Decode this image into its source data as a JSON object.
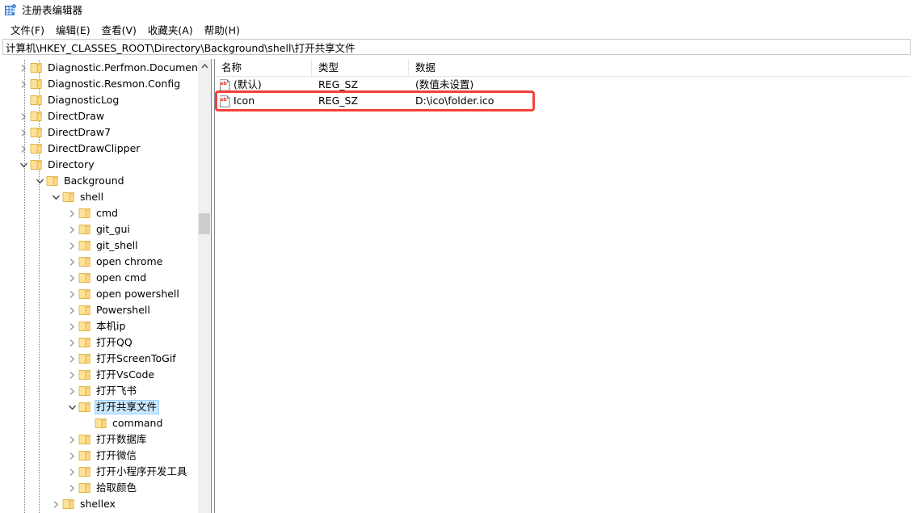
{
  "window": {
    "title": "注册表编辑器",
    "icon": "registry-editor-icon"
  },
  "menu": {
    "items": [
      {
        "label": "文件(F)",
        "name": "menu-file"
      },
      {
        "label": "编辑(E)",
        "name": "menu-edit"
      },
      {
        "label": "查看(V)",
        "name": "menu-view"
      },
      {
        "label": "收藏夹(A)",
        "name": "menu-favorites"
      },
      {
        "label": "帮助(H)",
        "name": "menu-help"
      }
    ]
  },
  "address": {
    "path": "计算机\\HKEY_CLASSES_ROOT\\Directory\\Background\\shell\\打开共享文件"
  },
  "tree": {
    "nodes": [
      {
        "label": "Diagnostic.Perfmon.Document",
        "depth": 1,
        "state": "collapsed",
        "selected": false
      },
      {
        "label": "Diagnostic.Resmon.Config",
        "depth": 1,
        "state": "collapsed",
        "selected": false
      },
      {
        "label": "DiagnosticLog",
        "depth": 1,
        "state": "leaf",
        "selected": false
      },
      {
        "label": "DirectDraw",
        "depth": 1,
        "state": "collapsed",
        "selected": false
      },
      {
        "label": "DirectDraw7",
        "depth": 1,
        "state": "collapsed",
        "selected": false
      },
      {
        "label": "DirectDrawClipper",
        "depth": 1,
        "state": "collapsed",
        "selected": false
      },
      {
        "label": "Directory",
        "depth": 1,
        "state": "expanded",
        "selected": false
      },
      {
        "label": "Background",
        "depth": 2,
        "state": "expanded",
        "selected": false
      },
      {
        "label": "shell",
        "depth": 3,
        "state": "expanded",
        "selected": false
      },
      {
        "label": "cmd",
        "depth": 4,
        "state": "collapsed",
        "selected": false
      },
      {
        "label": "git_gui",
        "depth": 4,
        "state": "collapsed",
        "selected": false
      },
      {
        "label": "git_shell",
        "depth": 4,
        "state": "collapsed",
        "selected": false
      },
      {
        "label": "open chrome",
        "depth": 4,
        "state": "collapsed",
        "selected": false
      },
      {
        "label": "open cmd",
        "depth": 4,
        "state": "collapsed",
        "selected": false
      },
      {
        "label": "open powershell",
        "depth": 4,
        "state": "collapsed",
        "selected": false
      },
      {
        "label": "Powershell",
        "depth": 4,
        "state": "collapsed",
        "selected": false
      },
      {
        "label": "本机ip",
        "depth": 4,
        "state": "collapsed",
        "selected": false
      },
      {
        "label": "打开QQ",
        "depth": 4,
        "state": "collapsed",
        "selected": false
      },
      {
        "label": "打开ScreenToGif",
        "depth": 4,
        "state": "collapsed",
        "selected": false
      },
      {
        "label": "打开VsCode",
        "depth": 4,
        "state": "collapsed",
        "selected": false
      },
      {
        "label": "打开飞书",
        "depth": 4,
        "state": "collapsed",
        "selected": false
      },
      {
        "label": "打开共享文件",
        "depth": 4,
        "state": "expanded",
        "selected": true
      },
      {
        "label": "command",
        "depth": 5,
        "state": "leaf",
        "selected": false
      },
      {
        "label": "打开数据库",
        "depth": 4,
        "state": "collapsed",
        "selected": false
      },
      {
        "label": "打开微信",
        "depth": 4,
        "state": "collapsed",
        "selected": false
      },
      {
        "label": "打开小程序开发工具",
        "depth": 4,
        "state": "collapsed",
        "selected": false
      },
      {
        "label": "拾取颜色",
        "depth": 4,
        "state": "collapsed",
        "selected": false
      },
      {
        "label": "shellex",
        "depth": 3,
        "state": "collapsed",
        "selected": false
      }
    ]
  },
  "list": {
    "columns": [
      {
        "label": "名称",
        "name": "column-name"
      },
      {
        "label": "类型",
        "name": "column-type"
      },
      {
        "label": "数据",
        "name": "column-data"
      }
    ],
    "rows": [
      {
        "icon": "string-value-icon",
        "name": "(默认)",
        "type": "REG_SZ",
        "data": "(数值未设置)",
        "highlighted": false
      },
      {
        "icon": "string-value-icon",
        "name": "Icon",
        "type": "REG_SZ",
        "data": "D:\\ico\\folder.ico",
        "highlighted": true
      }
    ]
  },
  "annotation": {
    "color": "#f4413c",
    "target_row_index": 1
  }
}
